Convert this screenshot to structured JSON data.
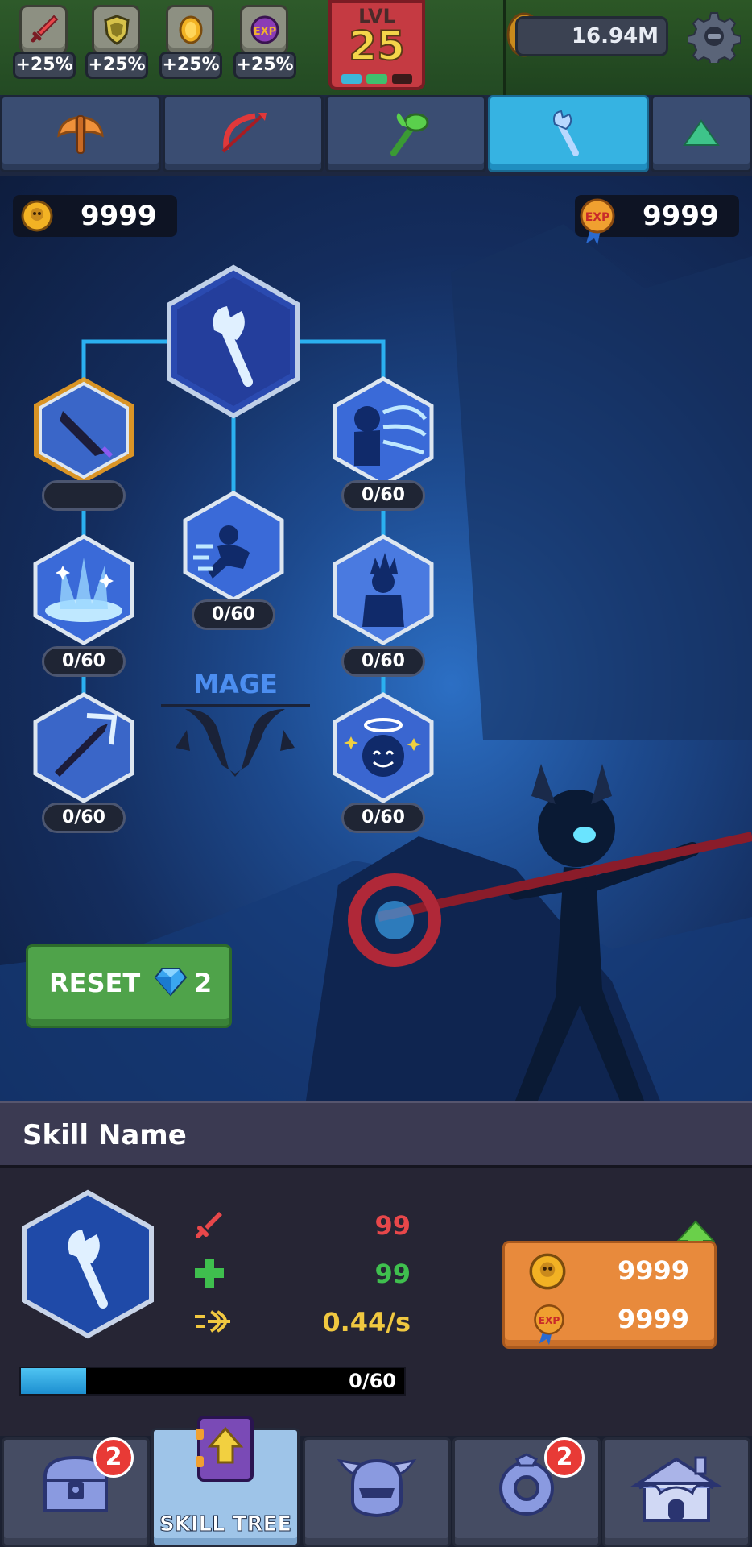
{
  "buffs": [
    {
      "icon": "sword-icon",
      "value": "+25%"
    },
    {
      "icon": "shield-icon",
      "value": "+25%"
    },
    {
      "icon": "coin-icon",
      "value": "+25%"
    },
    {
      "icon": "exp-icon",
      "value": "+25%"
    }
  ],
  "level": {
    "label": "LVL",
    "value": "25"
  },
  "gold_total": "16.94M",
  "category_tabs": [
    {
      "icon": "axe-icon",
      "active": false
    },
    {
      "icon": "bow-icon",
      "active": false
    },
    {
      "icon": "staff-green-icon",
      "active": false
    },
    {
      "icon": "wand-icon",
      "active": true
    },
    {
      "icon": "up-arrow-icon",
      "active": false
    }
  ],
  "currency": {
    "coins": "9999",
    "exp": "9999"
  },
  "skill_tree": {
    "class_name": "MAGE",
    "nodes": [
      {
        "id": "root",
        "count": ""
      },
      {
        "id": "left-1",
        "count": ""
      },
      {
        "id": "left-2",
        "count": "0/60"
      },
      {
        "id": "left-3",
        "count": "0/60"
      },
      {
        "id": "mid-1",
        "count": "0/60"
      },
      {
        "id": "right-1",
        "count": "0/60"
      },
      {
        "id": "right-2",
        "count": "0/60"
      },
      {
        "id": "right-3",
        "count": "0/60"
      }
    ]
  },
  "reset": {
    "label": "RESET",
    "gem_cost": "2"
  },
  "skill_detail": {
    "name": "Skill Name",
    "stats": [
      {
        "icon": "attack-icon",
        "value": "99",
        "color": "#e8474a"
      },
      {
        "icon": "health-icon",
        "value": "99",
        "color": "#3fbf4e"
      },
      {
        "icon": "speed-icon",
        "value": "0.44/s",
        "color": "#f0c840"
      }
    ],
    "upgrade_cost": {
      "coins": "9999",
      "exp": "9999"
    },
    "progress": {
      "text": "0/60",
      "fraction": 0.17
    }
  },
  "bottom_nav": [
    {
      "icon": "chest-icon",
      "label": "",
      "badge": "2",
      "active": false
    },
    {
      "icon": "skill-book-icon",
      "label": "SKILL TREE",
      "badge": "",
      "active": true
    },
    {
      "icon": "helmet-icon",
      "label": "",
      "badge": "",
      "active": false
    },
    {
      "icon": "gear-ring-icon",
      "label": "",
      "badge": "2",
      "active": false
    },
    {
      "icon": "castle-icon",
      "label": "",
      "badge": "",
      "active": false
    }
  ]
}
